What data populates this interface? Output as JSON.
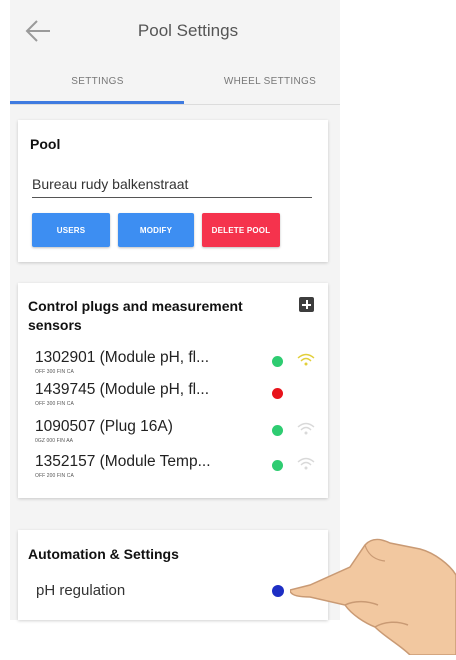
{
  "appbar": {
    "title": "Pool Settings",
    "back_icon": "arrow-left-icon"
  },
  "tabs": [
    {
      "label": "SETTINGS",
      "active": true
    },
    {
      "label": "WHEEL SETTINGS",
      "active": false
    }
  ],
  "pool": {
    "title": "Pool",
    "name_value": "Bureau rudy balkenstraat",
    "buttons": {
      "users": "USERS",
      "modify": "MODIFY",
      "delete": "DELETE POOL"
    }
  },
  "sensors": {
    "title": "Control plugs and measurement sensors",
    "add_icon": "plus-square-icon",
    "items": [
      {
        "label": "1302901 (Module pH, fl...",
        "sub": "OFF 300 FIN CA",
        "status_color": "#2ecc71",
        "wifi_color": "#e2cf3a"
      },
      {
        "label": "1439745 (Module pH, fl...",
        "sub": "OFF 300 FIN CA",
        "status_color": "#e8131b",
        "wifi_color": ""
      },
      {
        "label": "1090507 (Plug 16A)",
        "sub": "0GZ 000 FIN AA",
        "status_color": "#2ecc71",
        "wifi_color": "#d9d9d9"
      },
      {
        "label": "1352157 (Module Temp...",
        "sub": "OFF 200 FIN CA",
        "status_color": "#2ecc71",
        "wifi_color": "#d9d9d9"
      }
    ]
  },
  "automation": {
    "title": "Automation & Settings",
    "ph_label": "pH regulation",
    "ph_toggle_color": "#1d2ec4"
  },
  "colors": {
    "accent": "#3d8ef2",
    "danger": "#f5334d",
    "tab_indicator": "#3f7be0"
  }
}
